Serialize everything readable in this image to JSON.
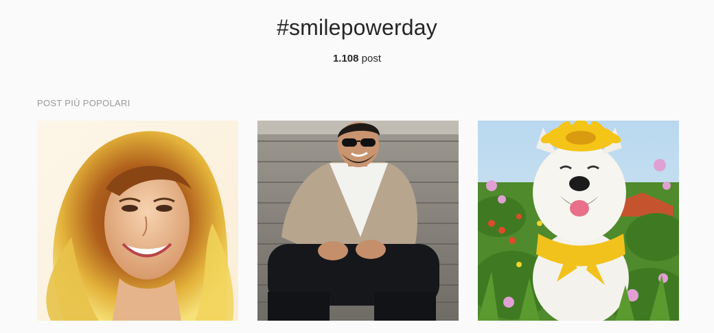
{
  "header": {
    "title": "#smilepowerday",
    "post_count_number": "1.108",
    "post_count_suffix": " post"
  },
  "top_posts": {
    "section_label": "POST PIÙ POPOLARI",
    "items": [
      {
        "subject": "smiling woman with long highlighted hair"
      },
      {
        "subject": "man in sunglasses sitting on stone steps"
      },
      {
        "subject": "white dog with sunflower crown in flower field"
      }
    ]
  },
  "colors": {
    "background": "#fafafa",
    "text": "#262626",
    "muted": "#999999"
  }
}
